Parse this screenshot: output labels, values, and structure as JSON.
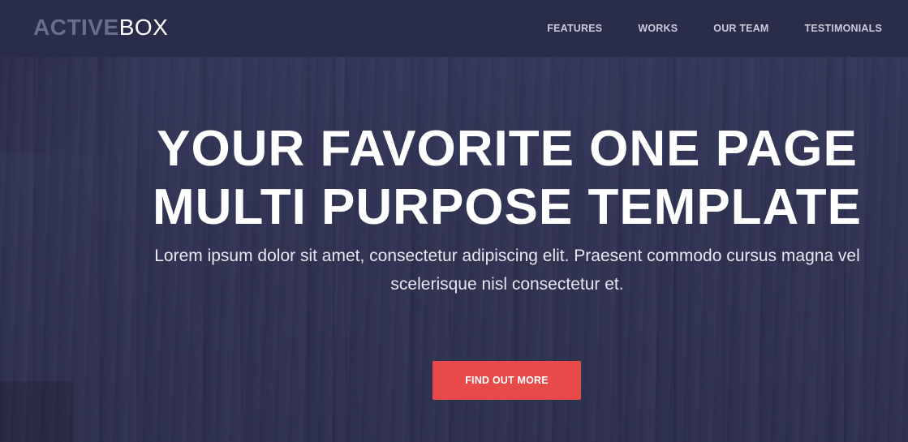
{
  "brand": {
    "logo_strong": "ACTIVE",
    "logo_light": "BOX"
  },
  "nav": {
    "items": [
      {
        "label": "FEATURES"
      },
      {
        "label": "WORKS"
      },
      {
        "label": "OUR TEAM"
      },
      {
        "label": "TESTIMONIALS"
      }
    ]
  },
  "hero": {
    "title_line_1": "YOUR FAVORITE ONE PAGE",
    "title_line_2": "MULTI PURPOSE TEMPLATE",
    "subtitle": "Lorem ipsum dolor sit amet, consectetur adipiscing elit. Praesent commodo cursus magna vel scelerisque nisl consectetur et.",
    "cta_label": "FIND OUT MORE"
  },
  "colors": {
    "navbar_bg": "#2a2d4a",
    "hero_bg": "#30334f",
    "accent": "#e84a4a",
    "logo_strong": "#6b6e8a"
  }
}
